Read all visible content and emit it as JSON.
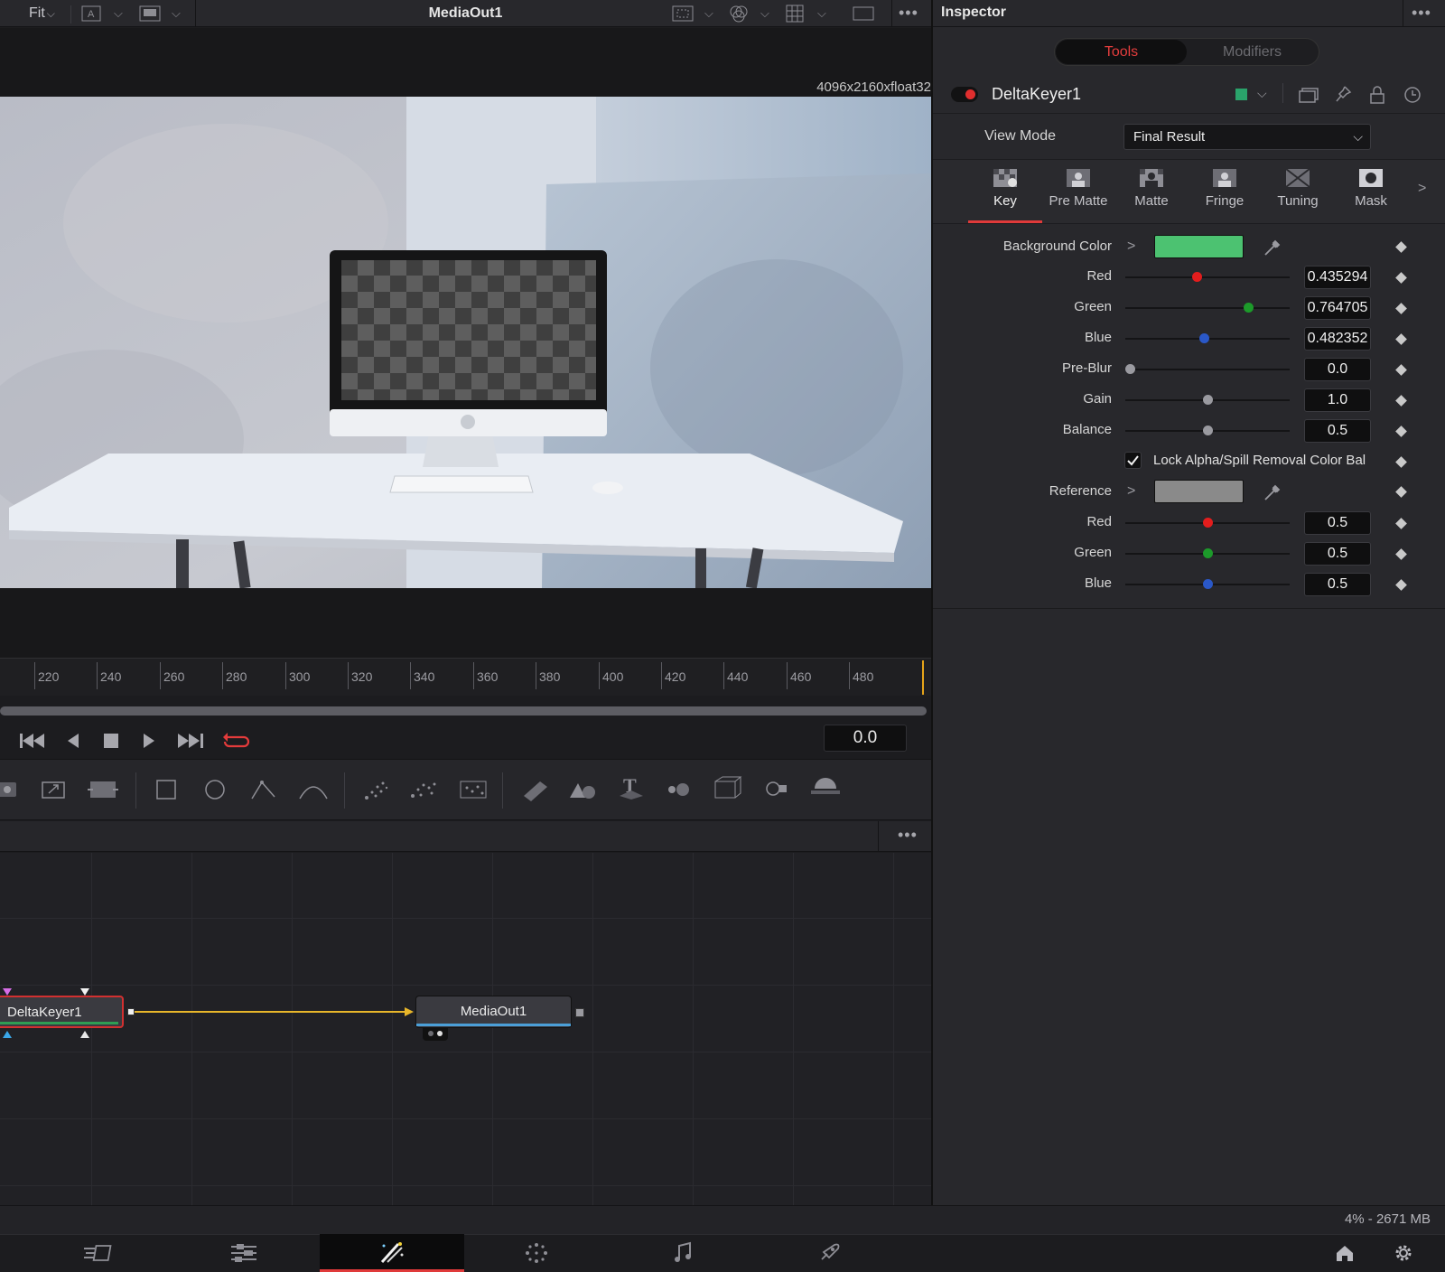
{
  "viewer": {
    "title": "MediaOut1",
    "fit_label": "Fit",
    "resolution": "4096x2160xfloat32",
    "ruler_ticks": [
      "220",
      "240",
      "260",
      "280",
      "300",
      "320",
      "340",
      "360",
      "380",
      "400",
      "420",
      "440",
      "460",
      "480"
    ],
    "time_value": "0.0"
  },
  "nodes": {
    "delta": "DeltaKeyer1",
    "mediaout": "MediaOut1"
  },
  "status": {
    "memory": "4% - 2671 MB"
  },
  "inspector": {
    "title": "Inspector",
    "segments": {
      "tools": "Tools",
      "modifiers": "Modifiers"
    },
    "tool_name": "DeltaKeyer1",
    "view_mode_label": "View Mode",
    "view_mode_value": "Final Result",
    "tabs": [
      "Key",
      "Pre Matte",
      "Matte",
      "Fringe",
      "Tuning",
      "Mask"
    ],
    "params": {
      "background_color": "Background Color",
      "red": "Red",
      "red_value": "0.435294",
      "green": "Green",
      "green_value": "0.764705",
      "blue": "Blue",
      "blue_value": "0.482352",
      "preblur": "Pre-Blur",
      "preblur_value": "0.0",
      "gain": "Gain",
      "gain_value": "1.0",
      "balance": "Balance",
      "balance_value": "0.5",
      "lock_label": "Lock Alpha/Spill Removal Color Bal",
      "reference": "Reference",
      "ref_red": "Red",
      "ref_red_value": "0.5",
      "ref_green": "Green",
      "ref_green_value": "0.5",
      "ref_blue": "Blue",
      "ref_blue_value": "0.5"
    },
    "colors": {
      "background_swatch": "#4cc271",
      "reference_swatch": "#8a8a8a",
      "accent": "#e03a3a",
      "tool_color": "#2aa36b"
    }
  }
}
